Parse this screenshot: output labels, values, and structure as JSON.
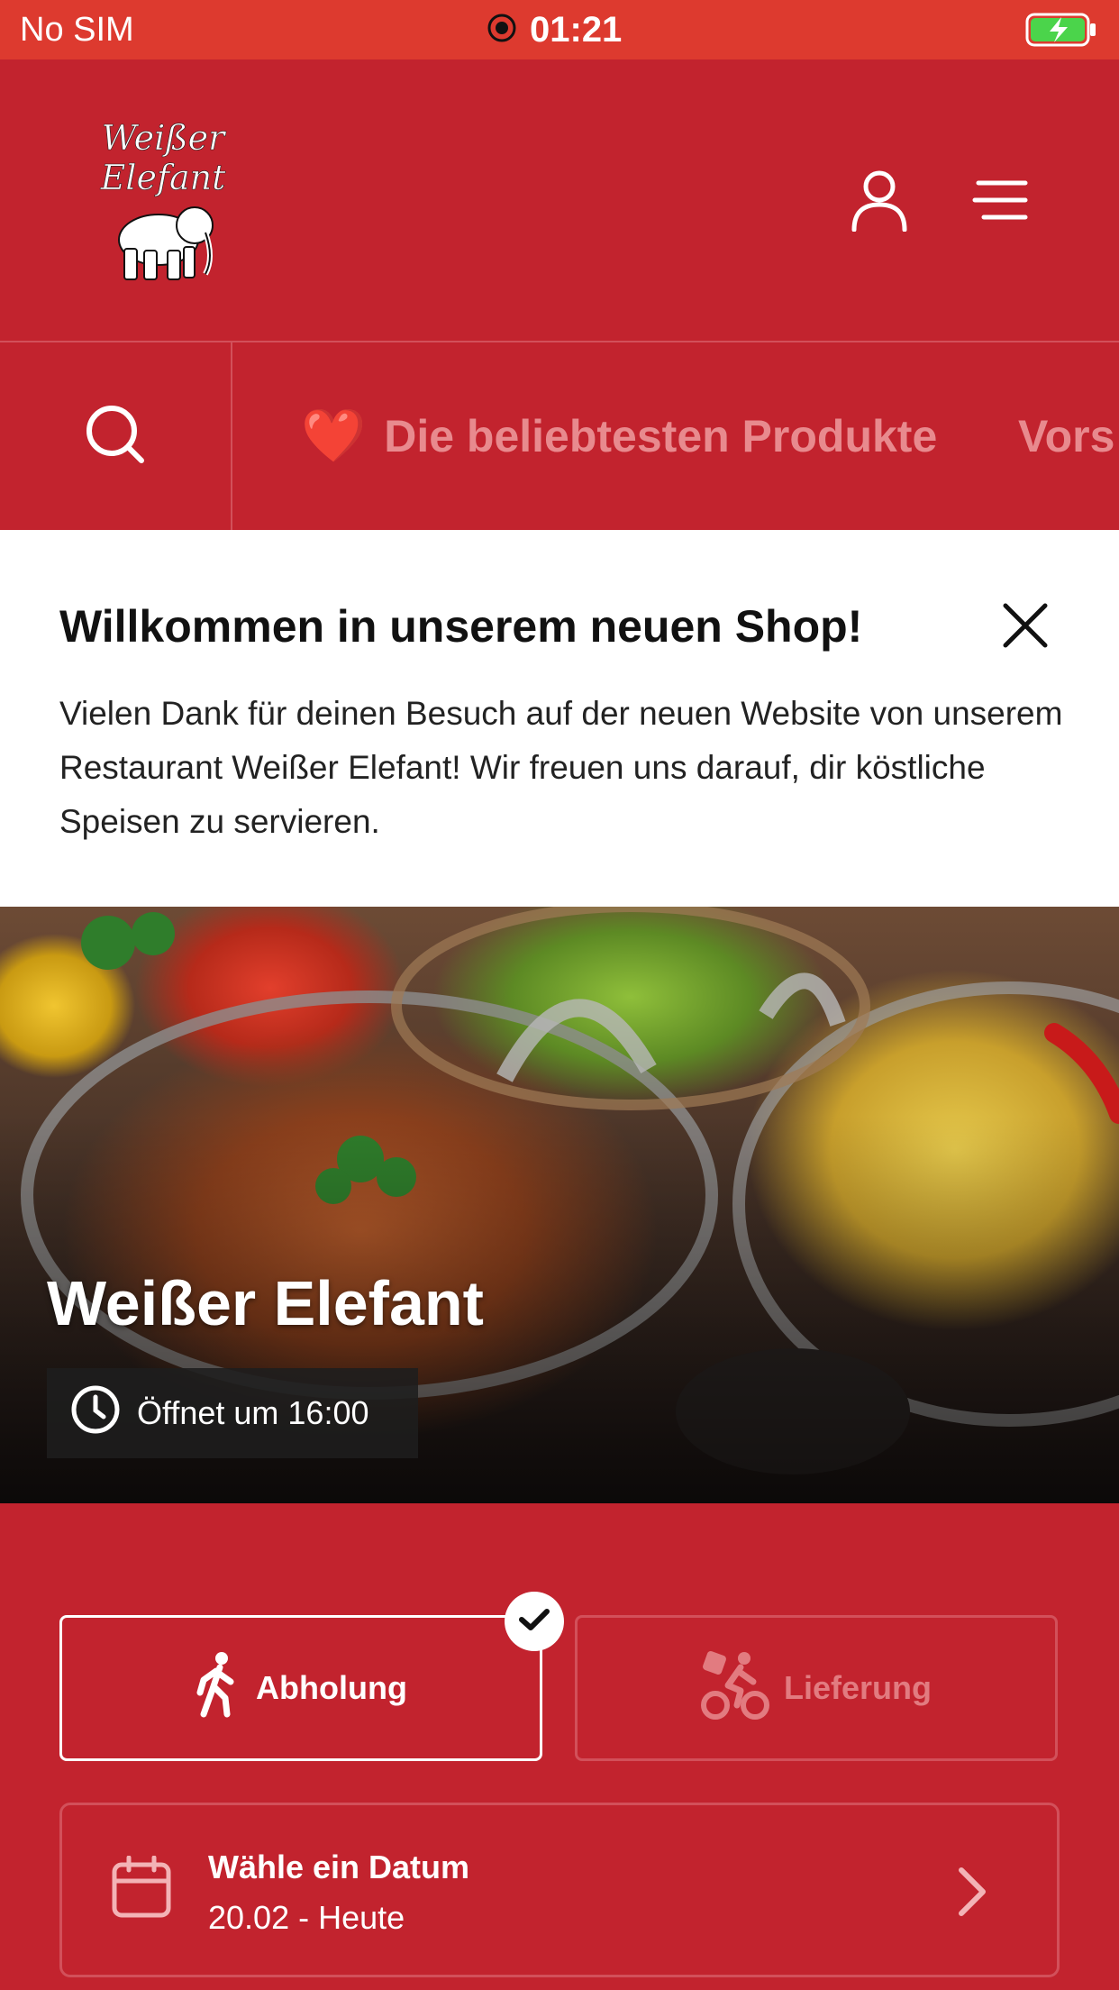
{
  "status_bar": {
    "carrier": "No SIM",
    "time": "01:21"
  },
  "header": {
    "logo_text_line1": "Weißer",
    "logo_text_line2": "Elefant"
  },
  "category_nav": {
    "items": [
      {
        "emoji": "❤️",
        "label": "Die beliebtesten Produkte"
      },
      {
        "label": "Vors"
      }
    ]
  },
  "welcome": {
    "title": "Willkommen in unserem neuen Shop!",
    "text": "Vielen Dank für deinen Besuch auf der neuen Website von unserem Restaurant Weißer Elefant! Wir freuen uns darauf, dir köstliche Speisen zu servieren."
  },
  "hero": {
    "restaurant_name": "Weißer Elefant",
    "hours": "Öffnet um 16:00"
  },
  "order_mode": {
    "pickup_label": "Abholung",
    "delivery_label": "Lieferung",
    "selected": "pickup"
  },
  "date_picker": {
    "title": "Wähle ein Datum",
    "value": "20.02 - Heute"
  },
  "colors": {
    "brand_red": "#c2232e",
    "status_bar": "#dd3a2f",
    "muted_red_text": "#e88a8e"
  }
}
